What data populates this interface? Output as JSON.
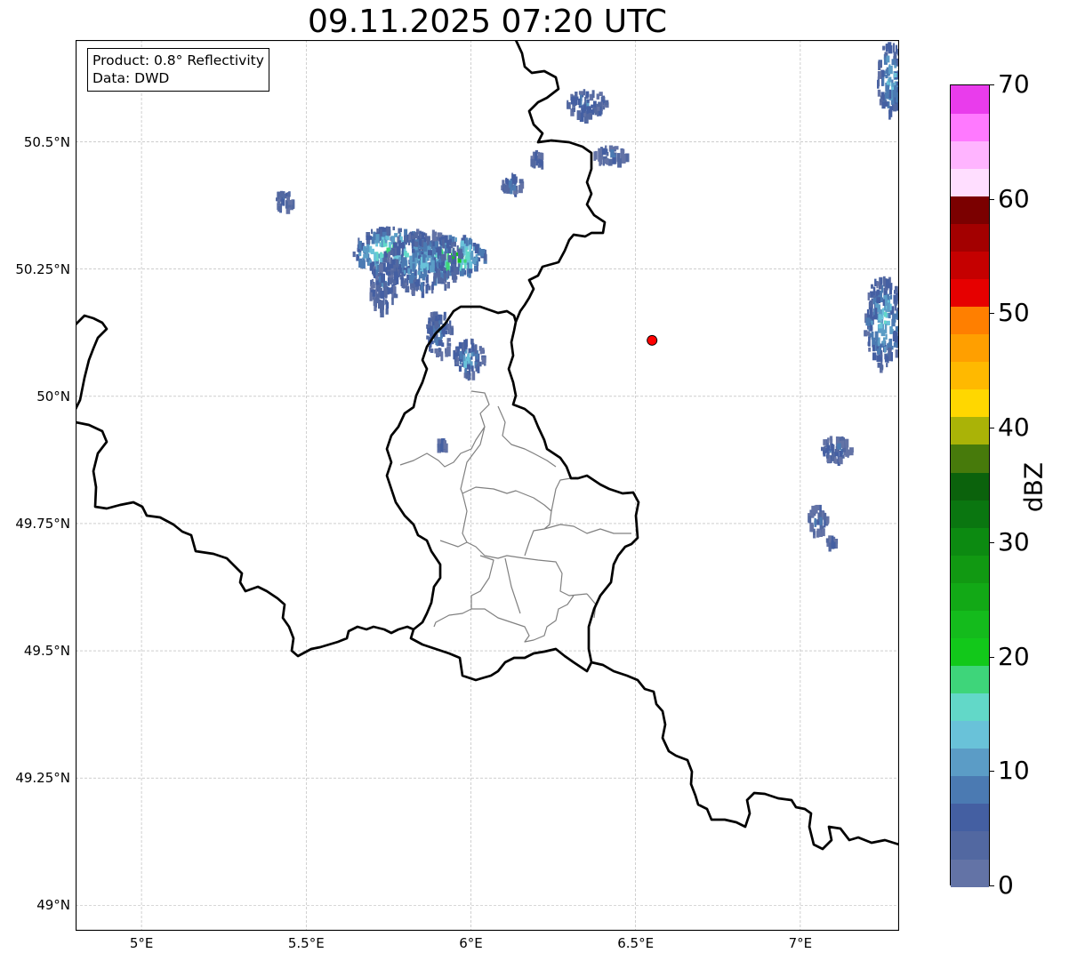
{
  "title": "09.11.2025 07:20 UTC",
  "info": {
    "line1": "Product: 0.8° Reflectivity",
    "line2": "Data: DWD"
  },
  "map": {
    "lon_range": [
      4.8,
      7.3
    ],
    "lat_range": [
      48.95,
      50.7
    ],
    "x_ticks": [
      {
        "lon": 5.0,
        "label": "5°E"
      },
      {
        "lon": 5.5,
        "label": "5.5°E"
      },
      {
        "lon": 6.0,
        "label": "6°E"
      },
      {
        "lon": 6.5,
        "label": "6.5°E"
      },
      {
        "lon": 7.0,
        "label": "7°E"
      }
    ],
    "y_ticks": [
      {
        "lat": 50.5,
        "label": "50.5°N"
      },
      {
        "lat": 50.25,
        "label": "50.25°N"
      },
      {
        "lat": 50.0,
        "label": "50°N"
      },
      {
        "lat": 49.75,
        "label": "49.75°N"
      },
      {
        "lat": 49.5,
        "label": "49.5°N"
      },
      {
        "lat": 49.25,
        "label": "49.25°N"
      },
      {
        "lat": 49.0,
        "label": "49°N"
      }
    ],
    "grid": true,
    "radar_site": {
      "lon": 6.55,
      "lat": 50.11,
      "color": "#ff0000"
    }
  },
  "colorbar": {
    "label": "dBZ",
    "min": 0,
    "max": 70,
    "ticks": [
      {
        "value": 0,
        "label": "0"
      },
      {
        "value": 10,
        "label": "10"
      },
      {
        "value": 20,
        "label": "20"
      },
      {
        "value": 30,
        "label": "30"
      },
      {
        "value": 40,
        "label": "40"
      },
      {
        "value": 50,
        "label": "50"
      },
      {
        "value": 60,
        "label": "60"
      },
      {
        "value": 70,
        "label": "70"
      }
    ],
    "colors": [
      "#6373a6",
      "#5268a1",
      "#445fa2",
      "#4b7ab2",
      "#5b9cc6",
      "#69c2d9",
      "#62d8c8",
      "#3ed57a",
      "#12c81a",
      "#14bb1c",
      "#12a916",
      "#119912",
      "#0c8a11",
      "#0a7610",
      "#0b620c",
      "#477a0b",
      "#aab307",
      "#ffd700",
      "#ffb900",
      "#ff9f00",
      "#ff7f00",
      "#e60000",
      "#c50000",
      "#a30000",
      "#7b0000",
      "#ffdeff",
      "#ffb4ff",
      "#ff79ff",
      "#e93cec"
    ]
  },
  "echoes": [
    {
      "lon": 5.75,
      "lat": 50.29,
      "rlon": 0.11,
      "rlat": 0.045,
      "intensity": 20
    },
    {
      "lon": 5.94,
      "lat": 50.28,
      "rlon": 0.1,
      "rlat": 0.04,
      "intensity": 22
    },
    {
      "lon": 5.85,
      "lat": 50.27,
      "rlon": 0.12,
      "rlat": 0.06,
      "intensity": 12
    },
    {
      "lon": 5.73,
      "lat": 50.22,
      "rlon": 0.04,
      "rlat": 0.05,
      "intensity": 8
    },
    {
      "lon": 5.9,
      "lat": 50.13,
      "rlon": 0.04,
      "rlat": 0.045,
      "intensity": 9
    },
    {
      "lon": 5.99,
      "lat": 50.08,
      "rlon": 0.05,
      "rlat": 0.035,
      "intensity": 12
    },
    {
      "lon": 5.43,
      "lat": 50.39,
      "rlon": 0.025,
      "rlat": 0.02,
      "intensity": 7
    },
    {
      "lon": 5.91,
      "lat": 49.91,
      "rlon": 0.015,
      "rlat": 0.012,
      "intensity": 6
    },
    {
      "lon": 6.35,
      "lat": 50.58,
      "rlon": 0.06,
      "rlat": 0.025,
      "intensity": 8
    },
    {
      "lon": 6.12,
      "lat": 50.42,
      "rlon": 0.03,
      "rlat": 0.02,
      "intensity": 8
    },
    {
      "lon": 6.2,
      "lat": 50.47,
      "rlon": 0.02,
      "rlat": 0.015,
      "intensity": 7
    },
    {
      "lon": 6.42,
      "lat": 50.48,
      "rlon": 0.05,
      "rlat": 0.015,
      "intensity": 7
    },
    {
      "lon": 7.27,
      "lat": 50.63,
      "rlon": 0.04,
      "rlat": 0.07,
      "intensity": 14
    },
    {
      "lon": 7.25,
      "lat": 50.15,
      "rlon": 0.06,
      "rlat": 0.09,
      "intensity": 14
    },
    {
      "lon": 7.1,
      "lat": 49.9,
      "rlon": 0.05,
      "rlat": 0.025,
      "intensity": 7
    },
    {
      "lon": 7.05,
      "lat": 49.76,
      "rlon": 0.03,
      "rlat": 0.03,
      "intensity": 7
    },
    {
      "lon": 7.09,
      "lat": 49.72,
      "rlon": 0.015,
      "rlat": 0.01,
      "intensity": 7
    }
  ]
}
